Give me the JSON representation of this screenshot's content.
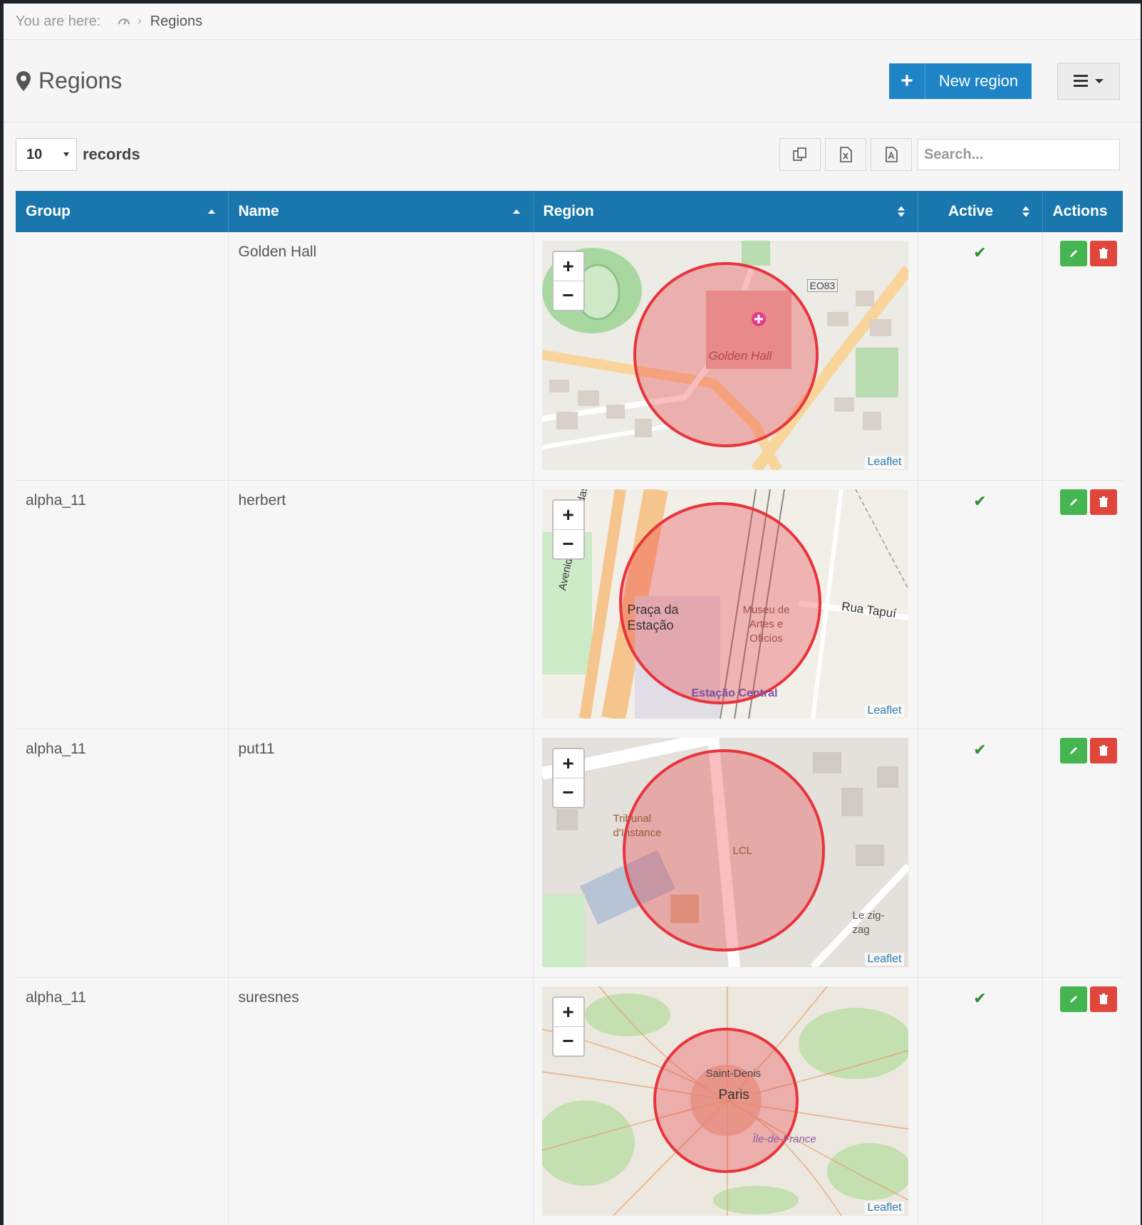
{
  "breadcrumb": {
    "prefix": "You are here:",
    "current": "Regions"
  },
  "header": {
    "title": "Regions",
    "new_button": "New region"
  },
  "toolbar": {
    "page_size": "10",
    "records_label": "records",
    "search_placeholder": "Search..."
  },
  "table": {
    "columns": [
      "Group",
      "Name",
      "Region",
      "Active",
      "Actions"
    ],
    "rows": [
      {
        "group": "",
        "name": "Golden Hall",
        "active": "✔",
        "map": {
          "labels": [
            "Golden Hall",
            "EO83"
          ],
          "attribution": "Leaflet"
        }
      },
      {
        "group": "alpha_11",
        "name": "herbert",
        "active": "✔",
        "map": {
          "labels": [
            "Praça da Estação",
            "Museu de Artes e Ofícios",
            "Estação Central",
            "Avenida dos Andradas",
            "Rua Tapuí"
          ],
          "attribution": "Leaflet"
        }
      },
      {
        "group": "alpha_11",
        "name": "put11",
        "active": "✔",
        "map": {
          "labels": [
            "Tribunal d'Instance",
            "LCL",
            "Le zig-zag"
          ],
          "attribution": "Leaflet"
        }
      },
      {
        "group": "alpha_11",
        "name": "suresnes",
        "active": "✔",
        "map": {
          "labels": [
            "Saint-Denis",
            "Paris",
            "Île-de-France"
          ],
          "attribution": "Leaflet"
        }
      }
    ]
  },
  "colors": {
    "header_bg": "#1a77ad",
    "primary": "#1e84c6",
    "edit": "#45b552",
    "delete": "#e0473c",
    "region_circle": "#e8343c"
  },
  "icons": [
    "home-icon",
    "map-marker-icon",
    "plus-icon",
    "menu-icon",
    "copy-icon",
    "excel-icon",
    "pdf-icon",
    "check-icon",
    "pencil-icon",
    "trash-icon"
  ]
}
